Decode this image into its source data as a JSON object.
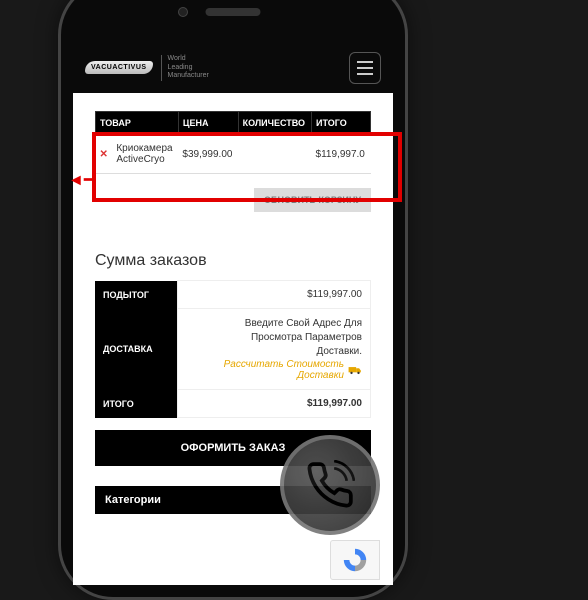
{
  "header": {
    "brand": "VACUACTIVUS",
    "tagline_l1": "World",
    "tagline_l2": "Leading",
    "tagline_l3": "Manufacturer"
  },
  "cart_headers": {
    "product": "ТОВАР",
    "price": "ЦЕНА",
    "qty": "КОЛИЧЕСТВО",
    "total": "ИТОГО"
  },
  "cart_row": {
    "name_l1": "Криокамера",
    "name_l2": "ActiveCryo",
    "price": "$39,999.00",
    "total": "$119,997.0"
  },
  "buttons": {
    "update": "ОБНОВИТЬ КОРЗИНУ",
    "checkout": "ОФОРМИТЬ ЗАКАЗ"
  },
  "totals": {
    "title": "Сумма заказов",
    "subtotal_label": "ПОДЫТОГ",
    "subtotal_value": "$119,997.00",
    "shipping_label": "ДОСТАВКА",
    "shipping_text_l1": "Введите Свой Адрес Для",
    "shipping_text_l2": "Просмотра Параметров",
    "shipping_text_l3": "Доставки.",
    "shipping_link_l1": "Рассчитать Стоимость",
    "shipping_link_l2": "Доставки",
    "total_label": "ИТОГО",
    "total_value": "$119,997.00"
  },
  "categories": "Категории"
}
